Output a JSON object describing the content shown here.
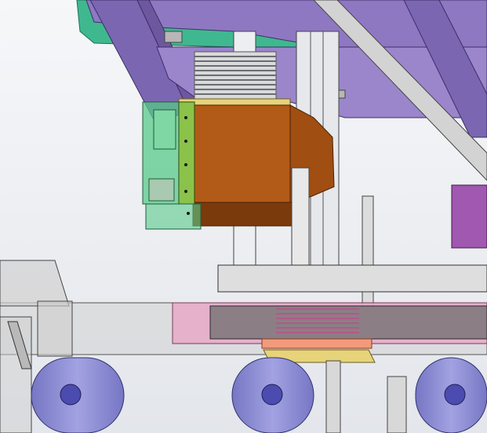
{
  "viewport": {
    "name": "cad-3d-assembly-view",
    "background_top": "#f6f7f9",
    "background_bottom": "#e4e7ec"
  },
  "colors": {
    "purple_frame": "#8e78c2",
    "purple_frame_dark": "#6d58a0",
    "teal_plate": "#3fb88f",
    "bellows": "#8a8d92",
    "orange_housing": "#b25a17",
    "orange_housing_dark": "#7a3a0c",
    "green_transparent": "#58c98a",
    "grey_structure": "#c9c9c9",
    "pink_transparent": "#e7a6c6",
    "yellow_plate": "#e6d37a",
    "roller_blue": "#8f8fd6",
    "roller_center": "#4b4bb0",
    "magenta_block": "#a058b0"
  }
}
